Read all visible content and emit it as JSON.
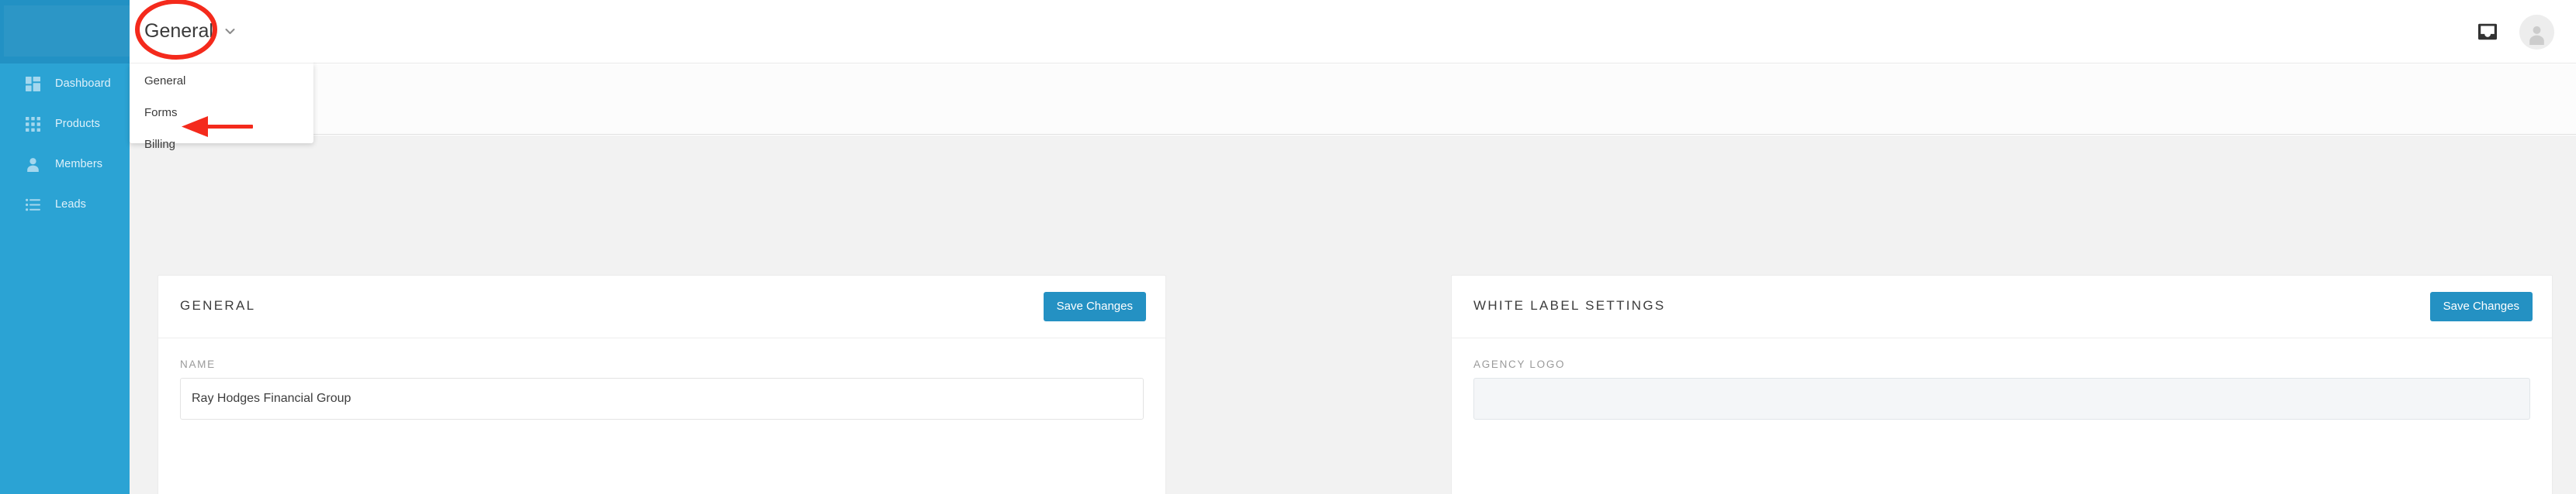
{
  "sidebar": {
    "logo": {
      "name": "app-logo"
    },
    "items": [
      {
        "label": "Dashboard",
        "icon": "dashboard-grid-icon"
      },
      {
        "label": "Products",
        "icon": "products-grid-icon"
      },
      {
        "label": "Members",
        "icon": "person-icon"
      },
      {
        "label": "Leads",
        "icon": "list-icon"
      }
    ]
  },
  "header": {
    "inbox_icon": "inbox-icon",
    "avatar_icon": "user-avatar-icon"
  },
  "settings_select": {
    "value": "General",
    "caret_icon": "chevron-down-icon",
    "options": [
      "General",
      "Forms",
      "Billing"
    ]
  },
  "cards": {
    "general": {
      "title": "GENERAL",
      "save_label": "Save Changes",
      "fields": [
        {
          "label": "NAME",
          "value": "Ray Hodges Financial Group",
          "placeholder": "Name"
        }
      ]
    },
    "white_label": {
      "title": "WHITE LABEL SETTINGS",
      "save_label": "Save Changes",
      "fields": [
        {
          "label": "AGENCY LOGO",
          "value": "",
          "placeholder": ""
        }
      ]
    }
  },
  "annotations": {
    "color": "#f42a1c",
    "ellipse_target": "General",
    "arrow_target": "Billing"
  },
  "theme": {
    "sidebar_bg": "#2ba3d4",
    "sidebar_logo_bg": "#2291c4",
    "accent": "#2491c3",
    "page_bg": "#f2f2f2",
    "annotation_red": "#f42a1c"
  }
}
